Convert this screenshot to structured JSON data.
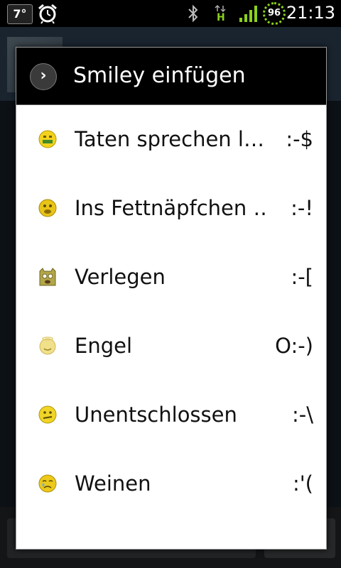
{
  "status_bar": {
    "temperature": "7°",
    "battery_level": "96",
    "time": "21:13",
    "data_indicator": "H",
    "icons": [
      "alarm-clock-icon",
      "bluetooth-icon",
      "data-arrows-icon",
      "signal-strength-icon",
      "battery-ring-icon"
    ],
    "accent_color": "#8bd11d"
  },
  "dialog": {
    "title": "Smiley einfügen",
    "title_icon": "chevron-right-icon",
    "items": [
      {
        "label": "Taten sprechen l…",
        "code": ":-$",
        "icon": "money-mouth-smiley-icon",
        "color": "#f3d21c"
      },
      {
        "label": "Ins Fettnäpfchen …",
        "code": ":-!",
        "icon": "foot-in-mouth-smiley-icon",
        "color": "#e8c417"
      },
      {
        "label": "Verlegen",
        "code": ":-[",
        "icon": "embarrassed-smiley-icon",
        "color": "#b2a64a"
      },
      {
        "label": "Engel",
        "code": "O:-)",
        "icon": "angel-smiley-icon",
        "color": "#f1e08a"
      },
      {
        "label": "Unentschlossen",
        "code": ":-\\",
        "icon": "undecided-smiley-icon",
        "color": "#f0d426"
      },
      {
        "label": "Weinen",
        "code": ":'(",
        "icon": "crying-smiley-icon",
        "color": "#ecc91b"
      }
    ]
  }
}
